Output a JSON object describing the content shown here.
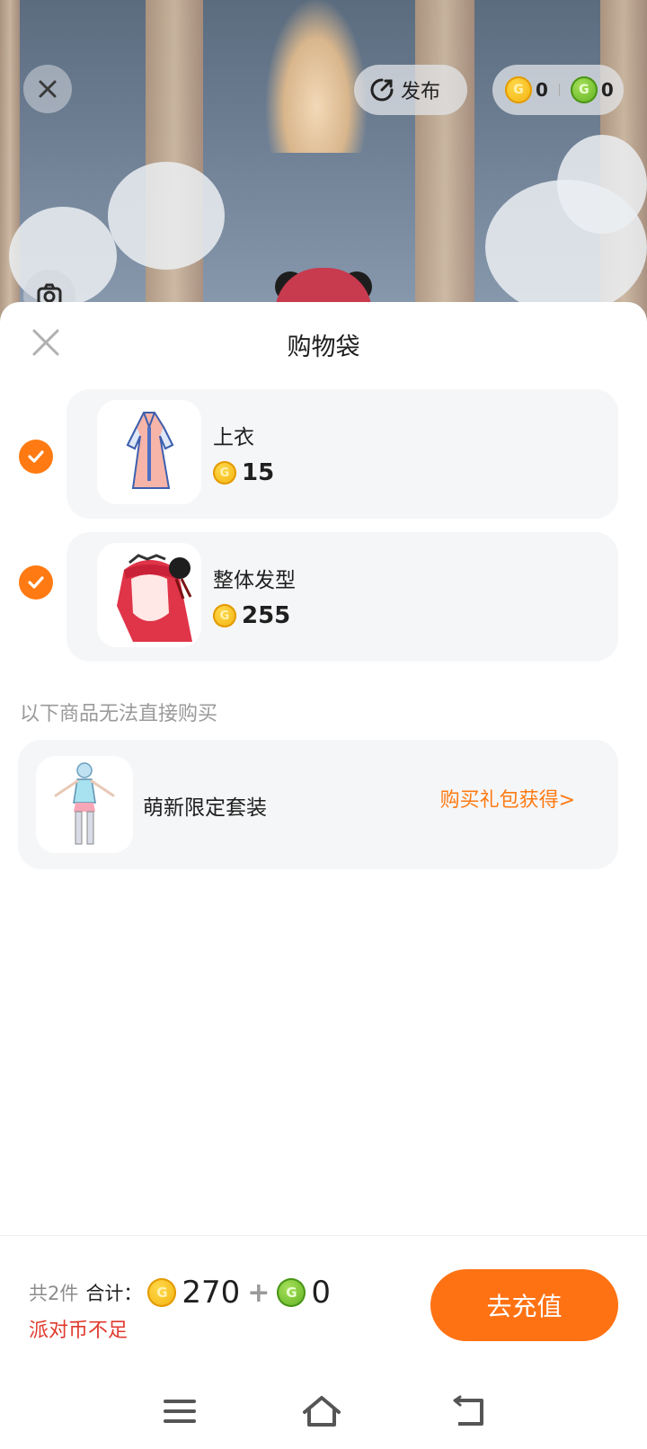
{
  "topbar": {
    "publish_label": "发布",
    "gold_balance": "0",
    "green_balance": "0"
  },
  "sheet": {
    "title": "购物袋",
    "items": [
      {
        "name": "上衣",
        "price": "15",
        "checked": true
      },
      {
        "name": "整体发型",
        "price": "255",
        "checked": true
      }
    ],
    "unavailable_label": "以下商品无法直接购买",
    "unavailable_items": [
      {
        "name": "萌新限定套装",
        "action_label": "购买礼包获得>"
      }
    ]
  },
  "footer": {
    "count_label": "共2件",
    "total_label": "合计：",
    "gold_total": "270",
    "plus": "+",
    "green_total": "0",
    "warning": "派对币不足",
    "recharge_label": "去充值"
  },
  "colors": {
    "accent": "#ff7214",
    "warning": "#e03a2e",
    "card_bg": "#f5f6f8"
  },
  "icons": {
    "close": "close-icon",
    "publish": "publish-icon",
    "camera": "camera-icon",
    "gold_coin": "gold-coin-icon",
    "green_coin": "green-coin-icon",
    "check": "check-icon",
    "nav_menu": "menu-icon",
    "nav_home": "home-icon",
    "nav_back": "back-icon"
  }
}
